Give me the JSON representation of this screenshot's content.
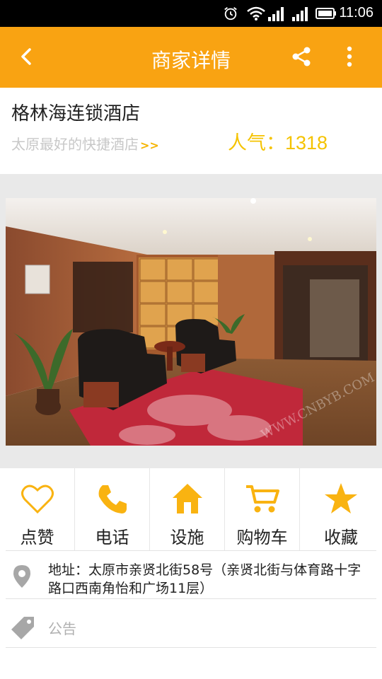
{
  "status_bar": {
    "time": "11:06",
    "icons": [
      "alarm-icon",
      "wifi-icon",
      "signal-icon",
      "signal-icon",
      "battery-icon"
    ]
  },
  "app_bar": {
    "title": "商家详情",
    "background_color": "#f9a312",
    "icons": [
      "back-arrow-icon",
      "share-icon",
      "more-vert-icon"
    ]
  },
  "shop": {
    "name": "格林海连锁酒店",
    "slogan": "太原最好的快捷酒店",
    "slogan_arrow": ">>",
    "popularity": "人气：1318",
    "accent_color": "#f5c300"
  },
  "photo": {
    "watermark": "WWW.CNBYB.COM"
  },
  "actions": [
    {
      "label": "点赞",
      "icon": "heart-icon"
    },
    {
      "label": "电话",
      "icon": "phone-icon"
    },
    {
      "label": "设施",
      "icon": "home-icon"
    },
    {
      "label": "购物车",
      "icon": "cart-icon"
    },
    {
      "label": "收藏",
      "icon": "star-icon"
    }
  ],
  "address": {
    "icon": "location-pin-icon",
    "text": "地址：太原市亲贤北街58号（亲贤北街与体育路十字路口西南角怡和广场11层）"
  },
  "notice": {
    "icon": "tag-icon",
    "label": "公告"
  }
}
